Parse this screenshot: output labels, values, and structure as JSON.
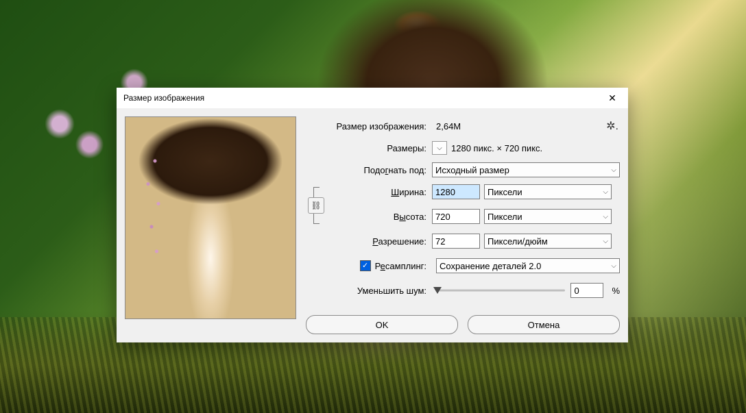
{
  "dialog": {
    "title": "Размер изображения",
    "imagesize_label": "Размер изображения:",
    "imagesize_value": "2,64M",
    "dimensions_label": "Размеры:",
    "dimensions_value": "1280 пикс.  ×  720 пикс.",
    "fit_label_pre": "Подо",
    "fit_label_u": "г",
    "fit_label_post": "нать под:",
    "fit_value": "Исходный размер",
    "width_label_u": "Ш",
    "width_label_post": "ирина:",
    "width_value": "1280",
    "width_unit": "Пиксели",
    "height_label_pre": "В",
    "height_label_u": "ы",
    "height_label_post": "сота:",
    "height_value": "720",
    "height_unit": "Пиксели",
    "resolution_label_u": "Р",
    "resolution_label_post": "азрешение:",
    "resolution_value": "72",
    "resolution_unit": "Пиксели/дюйм",
    "resample_label_pre": "Р",
    "resample_label_u": "е",
    "resample_label_post": "самплинг:",
    "resample_value": "Сохранение деталей 2.0",
    "resample_checked": true,
    "noise_label": "Уменьшить шум:",
    "noise_value": "0",
    "noise_suffix": "%",
    "ok": "OK",
    "cancel": "Отмена"
  }
}
